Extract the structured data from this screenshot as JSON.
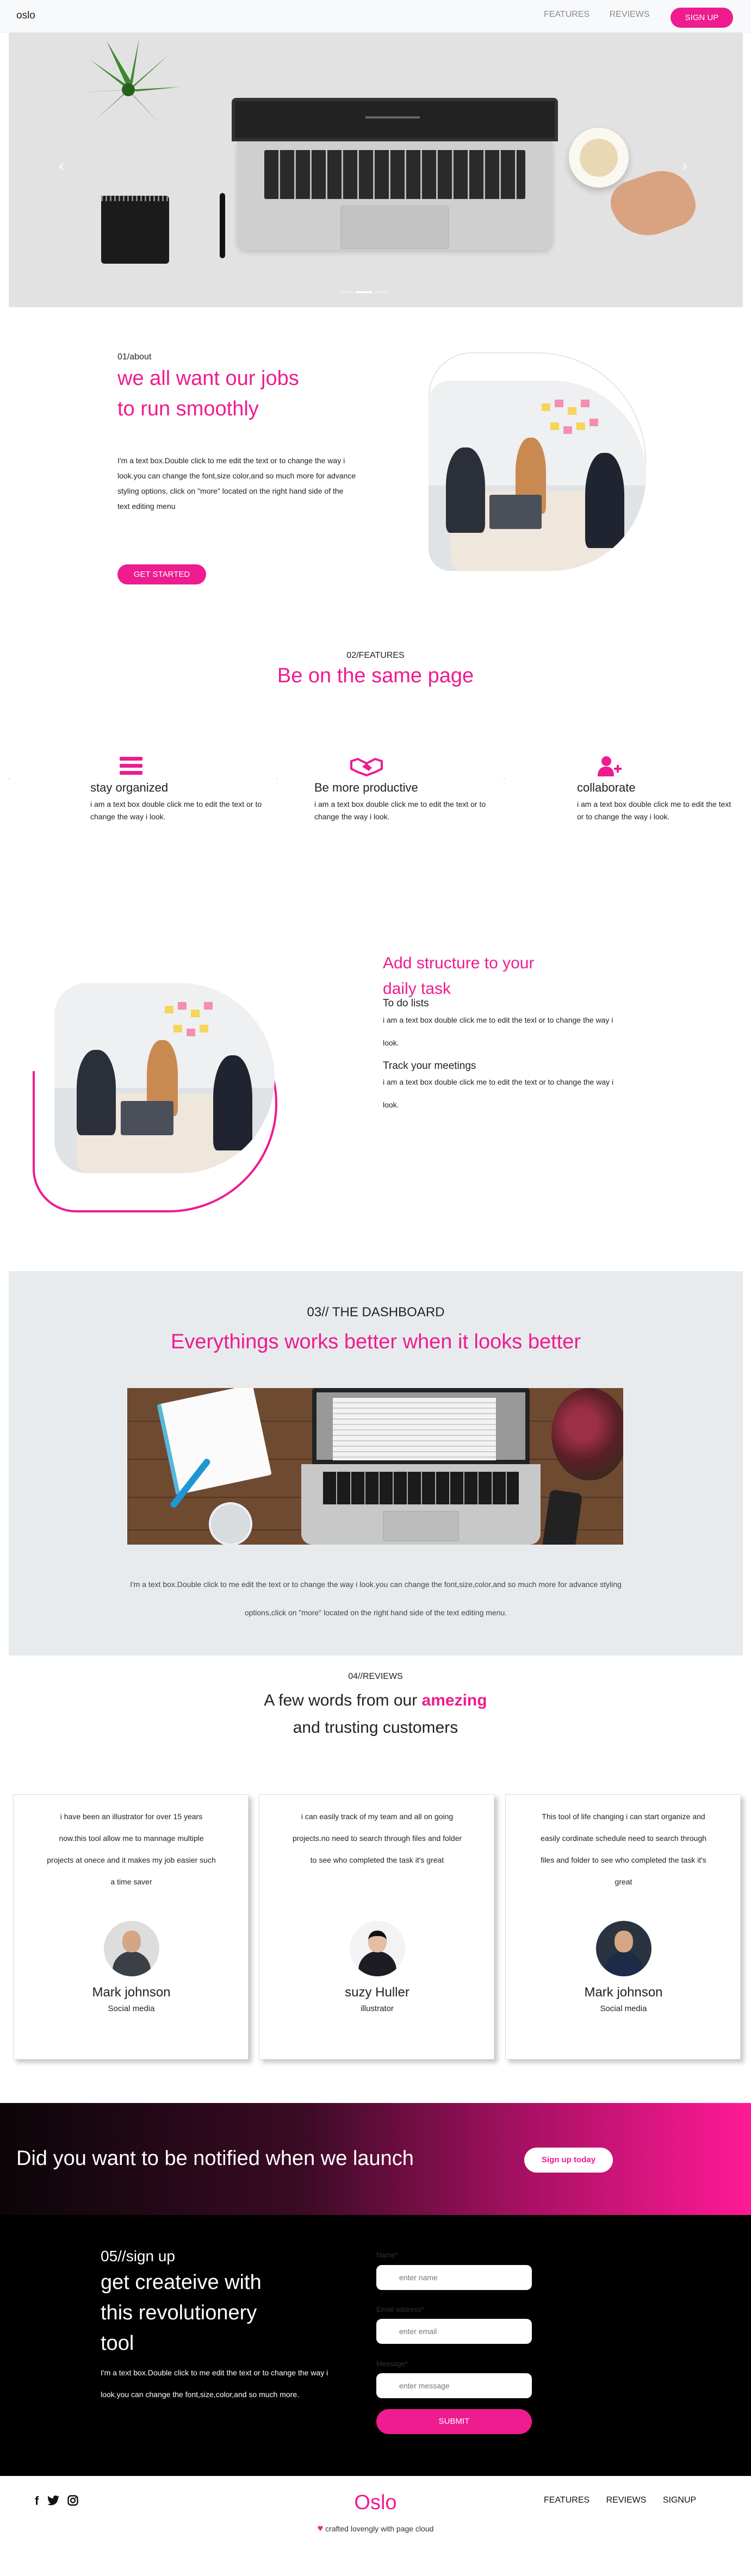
{
  "nav": {
    "brand": "oslo",
    "links": [
      "FEATURES",
      "REVIEWS"
    ],
    "signup": "SIGN UP"
  },
  "hero": {
    "prev_icon": "chevron-left-icon",
    "next_icon": "chevron-right-icon"
  },
  "about": {
    "sub": "01/about",
    "title": "we all want our jobs to run smoothly",
    "text": "I'm a text box.Double click to me edit the text or to change the way i look.you can change the font,size color,and so much more for advance styling options, click on \"more\" located on the right hand side of the text editing menu",
    "button": "GET STARTED"
  },
  "features": {
    "sub": "02/FEATURES",
    "title": "Be on the same page",
    "items": [
      {
        "title": "stay organized",
        "icon": "menu-icon",
        "desc": "i am a text box double click me to edit the text or to change the way i look."
      },
      {
        "title": "Be more productive",
        "icon": "handshake-icon",
        "desc": "i am a text box double click me to edit the text or to change the way i look."
      },
      {
        "title": "collaborate",
        "icon": "add-user-icon",
        "desc": "i am a text box double click me to edit the text or to change the way i look."
      }
    ]
  },
  "structure": {
    "title": "Add structure to your daily task",
    "h1": "To do lists",
    "p1": "i am a text box double click me to edit the texl or to change the way i look.",
    "h2": "Track your meetings",
    "p2": "i am a text box double click me to edit the text or to change the way i look."
  },
  "dashboard": {
    "sub": "03// THE DASHBOARD",
    "title": "Everythings works better when it looks better",
    "text": "I'm a text box.Double click to me edit the text or to change the way i look.you can change the font,size,color,and so much more for advance styling options,click on \"more\" located on the right hand side of the text editing menu."
  },
  "reviews": {
    "sub": "04//REVIEWS",
    "title_a": "A few words from our ",
    "title_b": "amezing",
    "title_c": "and trusting customers",
    "cards": [
      {
        "quote": "i have been an illustrator for over 15 years now.this tool allow me to mannage multiple projects at onece and it makes my job easier such a time saver",
        "name": "Mark johnson",
        "role": "Social media"
      },
      {
        "quote": "i can easily track of my team and all on going projects.no need to search through files and folder to see who completed the task it's great",
        "name": "suzy Huller",
        "role": "illustrator"
      },
      {
        "quote": "This tool of life changing i can start organize and easily cordinate schedule need to search through files and folder to see who completed the task it's great",
        "name": "Mark johnson",
        "role": "Social media"
      }
    ]
  },
  "notify": {
    "title": "Did you want to be notified when we launch",
    "button": "Sign up today"
  },
  "signup": {
    "sub": "05//sign up",
    "title": "get createive with this revolutionery tool",
    "text": "I'm a text box.Double click to me edit the text or to change the way i look.you can change the font,size,color,and so much more.",
    "name_label": "Name*",
    "name_placeholder": "enter name",
    "email_label": "Email address*",
    "email_placeholder": "enter email",
    "message_label": "Message*",
    "message_placeholder": "enter message",
    "submit": "SUBMIT"
  },
  "footer": {
    "social": [
      "f",
      "twitter-icon",
      "instagram-icon"
    ],
    "brand": "Oslo",
    "credit": "crafted lovengly with page cloud",
    "links": [
      "FEATURES",
      "REVIEWS",
      "SIGNUP"
    ]
  },
  "colors": {
    "accent": "#ee1c8f",
    "dash_bg": "#e8ebee",
    "dark": "#000000"
  }
}
